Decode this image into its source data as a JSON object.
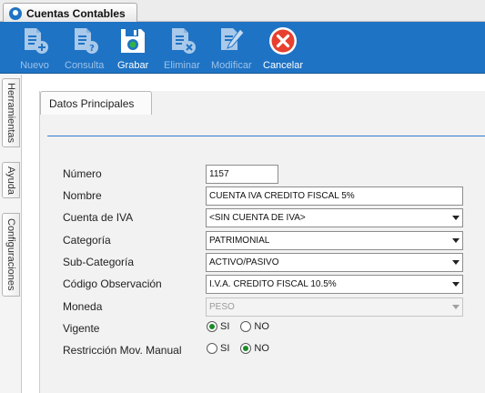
{
  "window": {
    "tab_title": "Cuentas Contables"
  },
  "toolbar": {
    "nuevo": "Nuevo",
    "consulta": "Consulta",
    "grabar": "Grabar",
    "eliminar": "Eliminar",
    "modificar": "Modificar",
    "cancelar": "Cancelar"
  },
  "sidebar": {
    "tabs": [
      "Herramientas",
      "Ayuda",
      "Configuraciones"
    ]
  },
  "section": {
    "title": "Datos Principales"
  },
  "form": {
    "numero": {
      "label": "Número",
      "value": "1157"
    },
    "nombre": {
      "label": "Nombre",
      "value": "CUENTA IVA CREDITO FISCAL 5%"
    },
    "cuenta_iva": {
      "label": "Cuenta de IVA",
      "value": "<SIN CUENTA DE IVA>"
    },
    "categoria": {
      "label": "Categoría",
      "value": "PATRIMONIAL"
    },
    "sub_categoria": {
      "label": "Sub-Categoría",
      "value": "ACTIVO/PASIVO"
    },
    "codigo_observacion": {
      "label": "Código Observación",
      "value": "I.V.A. CREDITO FISCAL 10.5%"
    },
    "moneda": {
      "label": "Moneda",
      "value": "PESO"
    },
    "vigente": {
      "label": "Vigente",
      "si": "SI",
      "no": "NO",
      "selected": "SI"
    },
    "restriccion": {
      "label": "Restricción Mov. Manual",
      "si": "SI",
      "no": "NO",
      "selected": "NO"
    }
  },
  "colors": {
    "toolbar": "#1f73c4",
    "cancel": "#e8402f",
    "radio_on": "#1a8a2a"
  }
}
